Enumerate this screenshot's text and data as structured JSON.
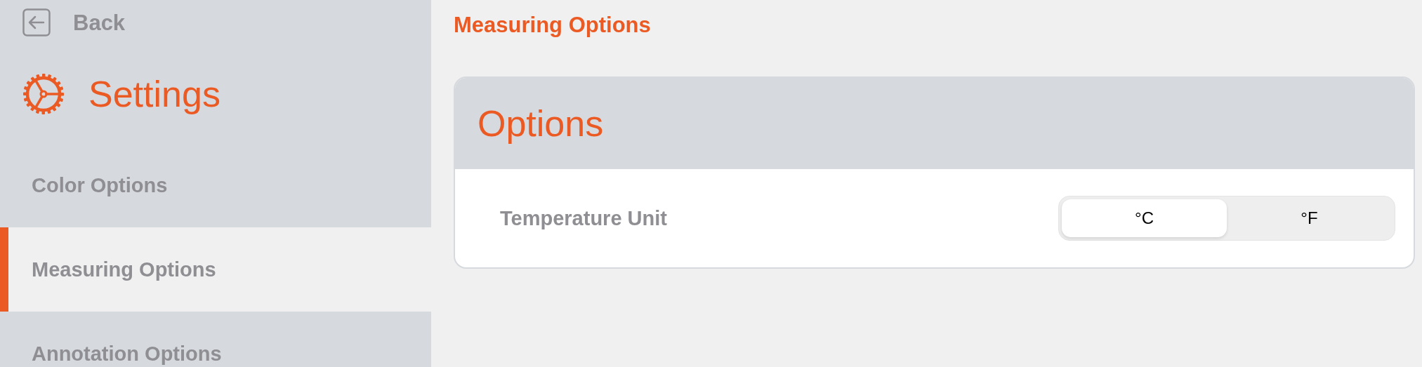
{
  "sidebar": {
    "back": "Back",
    "title": "Settings",
    "items": [
      {
        "label": "Color Options",
        "selected": false
      },
      {
        "label": "Measuring Options",
        "selected": true
      },
      {
        "label": "Annotation Options",
        "selected": false
      }
    ]
  },
  "page": {
    "title": "Measuring Options",
    "card": {
      "title": "Options",
      "rows": [
        {
          "label": "Temperature Unit",
          "segments": [
            {
              "label": "°C",
              "selected": true
            },
            {
              "label": "°F",
              "selected": false
            }
          ]
        }
      ]
    }
  }
}
